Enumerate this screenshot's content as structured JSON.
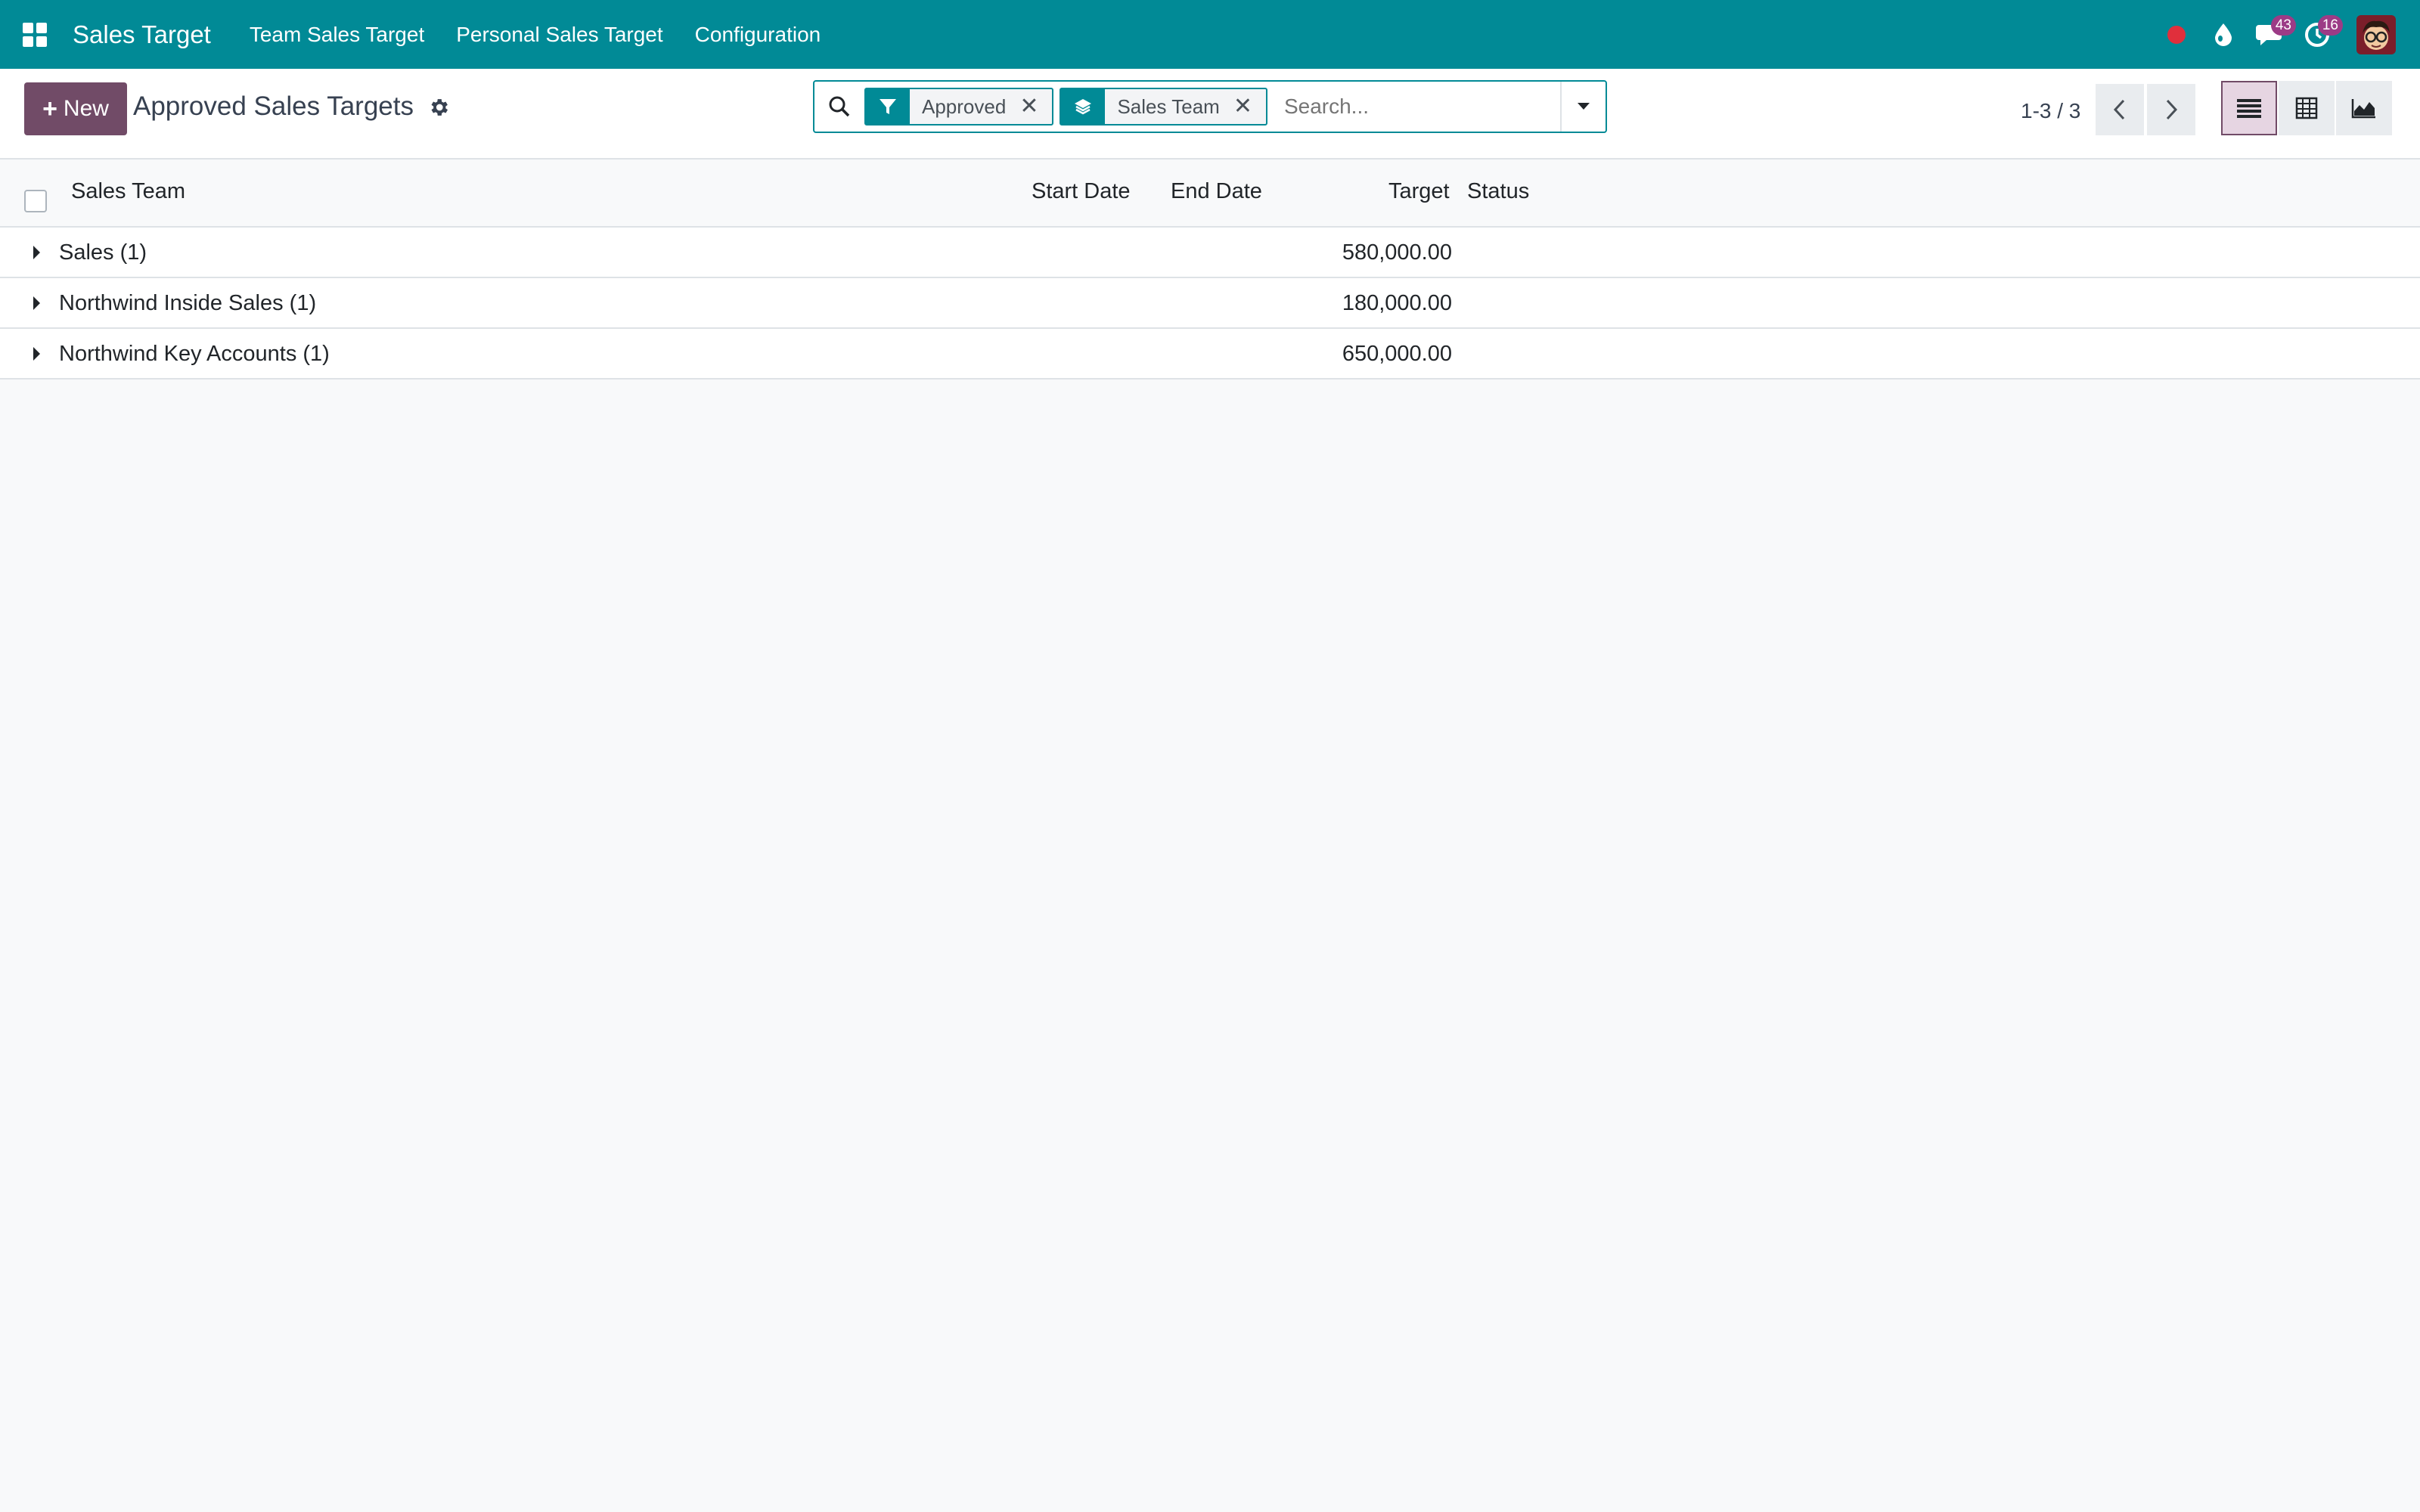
{
  "navbar": {
    "brand": "Sales Target",
    "menu": [
      "Team Sales Target",
      "Personal Sales Target",
      "Configuration"
    ],
    "messages_count": "43",
    "activities_count": "16",
    "colors": {
      "bar": "#018a96",
      "badge": "#9c3b86",
      "record_dot": "#e02f3c"
    }
  },
  "control_panel": {
    "new_label": "New",
    "title": "Approved Sales Targets",
    "search": {
      "facets": [
        {
          "icon": "filter-icon",
          "label": "Approved"
        },
        {
          "icon": "group-by-icon",
          "label": "Sales Team"
        }
      ],
      "placeholder": "Search..."
    },
    "pager": "1-3 / 3",
    "views": [
      "list-view",
      "pivot-view",
      "graph-view"
    ],
    "active_view": "list-view"
  },
  "table": {
    "columns": [
      "Sales Team",
      "Start Date",
      "End Date",
      "Target",
      "Status"
    ],
    "groups": [
      {
        "name": "Sales (1)",
        "target": "580,000.00"
      },
      {
        "name": "Northwind Inside Sales (1)",
        "target": "180,000.00"
      },
      {
        "name": "Northwind Key Accounts (1)",
        "target": "650,000.00"
      }
    ]
  }
}
